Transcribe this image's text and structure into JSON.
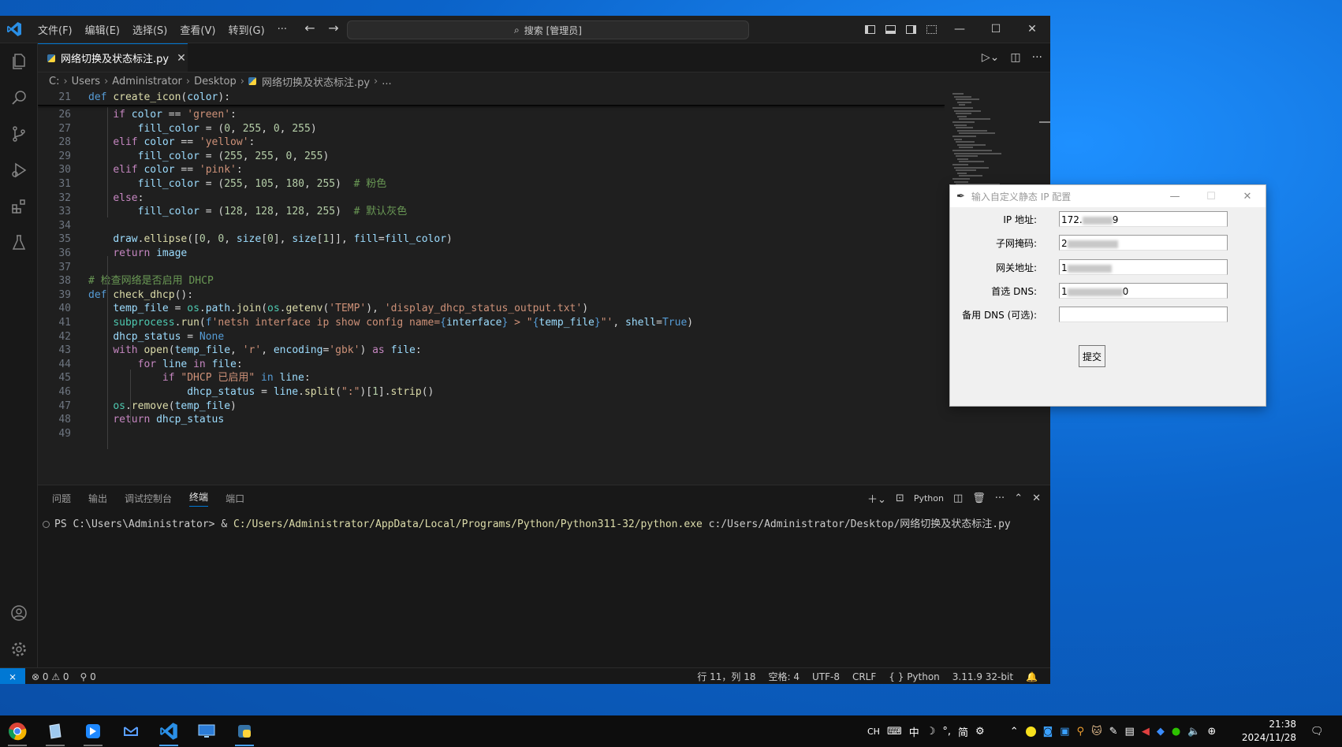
{
  "menu": [
    "文件(F)",
    "编辑(E)",
    "选择(S)",
    "查看(V)",
    "转到(G)",
    "···"
  ],
  "search": "搜索 [管理员]",
  "tab": {
    "title": "网络切换及状态标注.py"
  },
  "breadcrumb": [
    "C:",
    "Users",
    "Administrator",
    "Desktop",
    "网络切换及状态标注.py",
    "..."
  ],
  "code": {
    "sticky_ln": "21",
    "sticky_text": "def create_icon(color):",
    "lines": [
      {
        "ln": "26",
        "html": "    <span class='kw2'>if</span> <span class='var'>color</span> <span class='op'>==</span> <span class='str'>'green'</span><span class='pl'>:</span>"
      },
      {
        "ln": "27",
        "html": "        <span class='var'>fill_color</span> <span class='op'>=</span> <span class='pl'>(</span><span class='num'>0</span><span class='pl'>, </span><span class='num'>255</span><span class='pl'>, </span><span class='num'>0</span><span class='pl'>, </span><span class='num'>255</span><span class='pl'>)</span>"
      },
      {
        "ln": "28",
        "html": "    <span class='kw2'>elif</span> <span class='var'>color</span> <span class='op'>==</span> <span class='str'>'yellow'</span><span class='pl'>:</span>"
      },
      {
        "ln": "29",
        "html": "        <span class='var'>fill_color</span> <span class='op'>=</span> <span class='pl'>(</span><span class='num'>255</span><span class='pl'>, </span><span class='num'>255</span><span class='pl'>, </span><span class='num'>0</span><span class='pl'>, </span><span class='num'>255</span><span class='pl'>)</span>"
      },
      {
        "ln": "30",
        "html": "    <span class='kw2'>elif</span> <span class='var'>color</span> <span class='op'>==</span> <span class='str'>'pink'</span><span class='pl'>:</span>"
      },
      {
        "ln": "31",
        "html": "        <span class='var'>fill_color</span> <span class='op'>=</span> <span class='pl'>(</span><span class='num'>255</span><span class='pl'>, </span><span class='num'>105</span><span class='pl'>, </span><span class='num'>180</span><span class='pl'>, </span><span class='num'>255</span><span class='pl'>)</span>  <span class='cm'># 粉色</span>"
      },
      {
        "ln": "32",
        "html": "    <span class='kw2'>else</span><span class='pl'>:</span>"
      },
      {
        "ln": "33",
        "html": "        <span class='var'>fill_color</span> <span class='op'>=</span> <span class='pl'>(</span><span class='num'>128</span><span class='pl'>, </span><span class='num'>128</span><span class='pl'>, </span><span class='num'>128</span><span class='pl'>, </span><span class='num'>255</span><span class='pl'>)</span>  <span class='cm'># 默认灰色</span>"
      },
      {
        "ln": "34",
        "html": ""
      },
      {
        "ln": "35",
        "html": "    <span class='var'>draw</span><span class='pl'>.</span><span class='fn'>ellipse</span><span class='pl'>([</span><span class='num'>0</span><span class='pl'>, </span><span class='num'>0</span><span class='pl'>, </span><span class='var'>size</span><span class='pl'>[</span><span class='num'>0</span><span class='pl'>], </span><span class='var'>size</span><span class='pl'>[</span><span class='num'>1</span><span class='pl'>]], </span><span class='var'>fill</span><span class='op'>=</span><span class='var'>fill_color</span><span class='pl'>)</span>"
      },
      {
        "ln": "36",
        "html": "    <span class='kw2'>return</span> <span class='var'>image</span>"
      },
      {
        "ln": "37",
        "html": ""
      },
      {
        "ln": "38",
        "html": "<span class='cm'># 检查网络是否启用 DHCP</span>"
      },
      {
        "ln": "39",
        "html": "<span class='kw'>def</span> <span class='fn'>check_dhcp</span><span class='pl'>():</span>"
      },
      {
        "ln": "40",
        "html": "    <span class='var'>temp_file</span> <span class='op'>=</span> <span class='cls'>os</span><span class='pl'>.</span><span class='var'>path</span><span class='pl'>.</span><span class='fn'>join</span><span class='pl'>(</span><span class='cls'>os</span><span class='pl'>.</span><span class='fn'>getenv</span><span class='pl'>(</span><span class='str'>'TEMP'</span><span class='pl'>), </span><span class='str'>'display_dhcp_status_output.txt'</span><span class='pl'>)</span>"
      },
      {
        "ln": "41",
        "html": "    <span class='cls'>subprocess</span><span class='pl'>.</span><span class='fn'>run</span><span class='pl'>(</span><span class='kw'>f</span><span class='str'>'netsh interface ip show config name=</span><span class='kw'>{</span><span class='var'>interface</span><span class='kw'>}</span><span class='str'> &gt; \"</span><span class='kw'>{</span><span class='var'>temp_file</span><span class='kw'>}</span><span class='str'>\"'</span><span class='pl'>, </span><span class='var'>shell</span><span class='op'>=</span><span class='kw'>True</span><span class='pl'>)</span>"
      },
      {
        "ln": "42",
        "html": "    <span class='var'>dhcp_status</span> <span class='op'>=</span> <span class='kw'>None</span>"
      },
      {
        "ln": "43",
        "html": "    <span class='kw2'>with</span> <span class='fn'>open</span><span class='pl'>(</span><span class='var'>temp_file</span><span class='pl'>, </span><span class='str'>'r'</span><span class='pl'>, </span><span class='var'>encoding</span><span class='op'>=</span><span class='str'>'gbk'</span><span class='pl'>) </span><span class='kw2'>as</span> <span class='var'>file</span><span class='pl'>:</span>"
      },
      {
        "ln": "44",
        "html": "        <span class='kw2'>for</span> <span class='var'>line</span> <span class='kw2'>in</span> <span class='var'>file</span><span class='pl'>:</span>"
      },
      {
        "ln": "45",
        "html": "            <span class='kw2'>if</span> <span class='str'>\"DHCP 已启用\"</span> <span class='kw'>in</span> <span class='var'>line</span><span class='pl'>:</span>"
      },
      {
        "ln": "46",
        "html": "                <span class='var'>dhcp_status</span> <span class='op'>=</span> <span class='var'>line</span><span class='pl'>.</span><span class='fn'>split</span><span class='pl'>(</span><span class='str'>\":\"</span><span class='pl'>)[</span><span class='num'>1</span><span class='pl'>].</span><span class='fn'>strip</span><span class='pl'>()</span>"
      },
      {
        "ln": "47",
        "html": "    <span class='cls'>os</span><span class='pl'>.</span><span class='fn'>remove</span><span class='pl'>(</span><span class='var'>temp_file</span><span class='pl'>)</span>"
      },
      {
        "ln": "48",
        "html": "    <span class='kw2'>return</span> <span class='var'>dhcp_status</span>"
      },
      {
        "ln": "49",
        "html": ""
      }
    ]
  },
  "panel": {
    "tabs": [
      "问题",
      "输出",
      "调试控制台",
      "终端",
      "端口"
    ],
    "active_tab": "终端",
    "shell_label": "Python",
    "prompt": "PS C:\\Users\\Administrator> & ",
    "exe_path": "C:/Users/Administrator/AppData/Local/Programs/Python/Python311-32/python.exe",
    "script_arg": " c:/Users/Administrator/Desktop/网络切换及状态标注.py"
  },
  "status": {
    "errors": "0",
    "warnings": "0",
    "ports": "0",
    "position": "行 11，列 18",
    "spaces": "空格: 4",
    "encoding": "UTF-8",
    "eol": "CRLF",
    "language": "Python",
    "interpreter": "3.11.9 32-bit"
  },
  "dialog": {
    "title": "输入自定义静态 IP 配置",
    "fields": [
      {
        "label": "IP 地址:",
        "value": "172.",
        "suffix": "9"
      },
      {
        "label": "子网掩码:",
        "value": "2",
        "suffix": ""
      },
      {
        "label": "网关地址:",
        "value": "1",
        "suffix": ""
      },
      {
        "label": "首选 DNS:",
        "value": "1",
        "suffix": "0"
      },
      {
        "label": "备用 DNS (可选):",
        "value": "",
        "suffix": ""
      }
    ],
    "submit": "提交"
  },
  "taskbar": {
    "ime": [
      "CH",
      "中",
      "简"
    ],
    "time": "21:38",
    "date": "2024/11/28"
  },
  "colors": {
    "accent": "#0078d4",
    "editor_bg": "#1f1f1f",
    "sidebar_bg": "#181818",
    "desktop": "#0b63c9"
  }
}
